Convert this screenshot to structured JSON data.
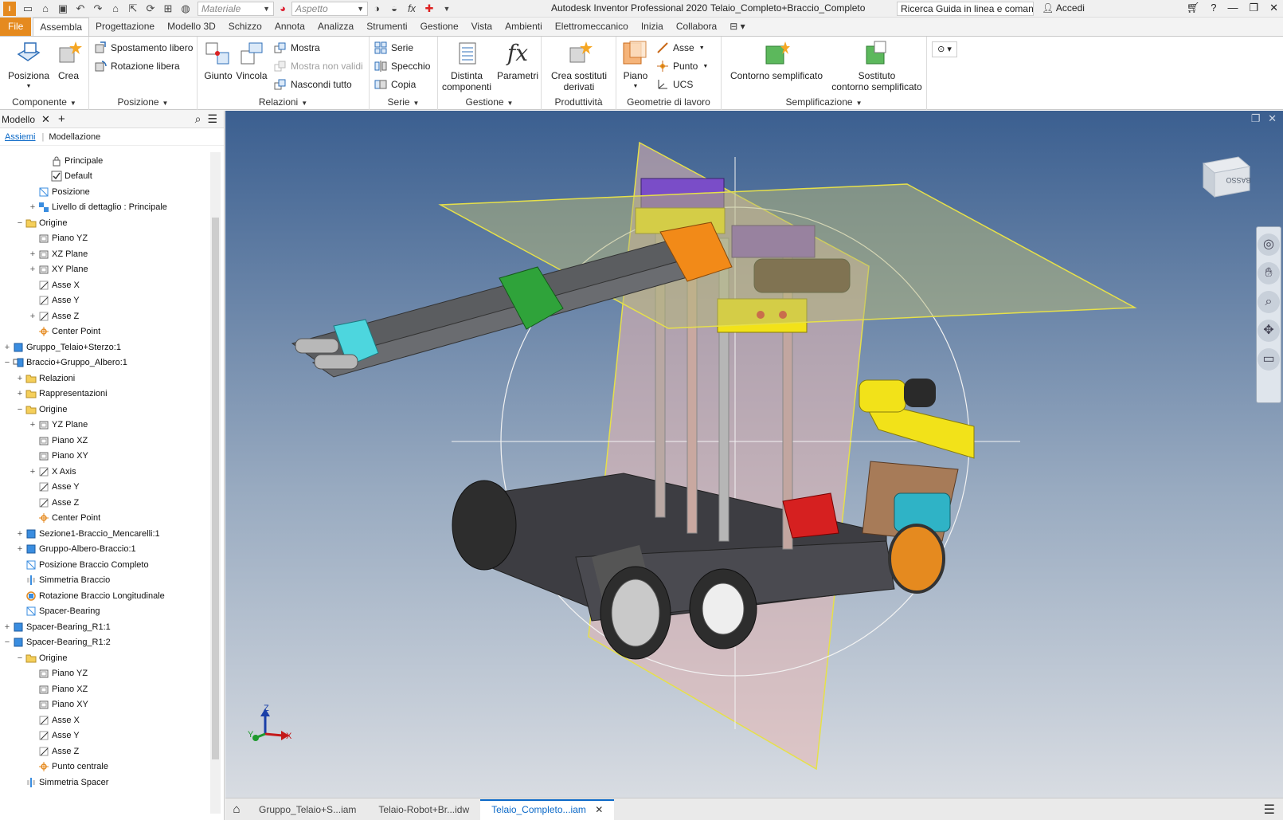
{
  "titlebar": {
    "material_placeholder": "Materiale",
    "appearance_placeholder": "Aspetto",
    "app_name": "Autodesk Inventor Professional 2020",
    "document": "Telaio_Completo+Braccio_Completo",
    "help_search": "Ricerca Guida in linea e comand",
    "sign_in": "Accedi"
  },
  "ribbon_tabs": [
    "File",
    "Assembla",
    "Progettazione",
    "Modello 3D",
    "Schizzo",
    "Annota",
    "Analizza",
    "Strumenti",
    "Gestione",
    "Vista",
    "Ambienti",
    "Elettromeccanico",
    "Inizia",
    "Collabora"
  ],
  "ribbon": {
    "componente": {
      "title": "Componente",
      "posiziona": "Posiziona",
      "crea": "Crea"
    },
    "posizione": {
      "title": "Posizione",
      "spostamento": "Spostamento libero",
      "rotazione": "Rotazione libera"
    },
    "relazioni": {
      "title": "Relazioni",
      "giunto": "Giunto",
      "vincola": "Vincola",
      "mostra": "Mostra",
      "mostra_non_validi": "Mostra non validi",
      "nascondi_tutto": "Nascondi tutto"
    },
    "serie": {
      "title": "Serie",
      "serie": "Serie",
      "specchio": "Specchio",
      "copia": "Copia"
    },
    "gestione": {
      "title": "Gestione",
      "distinta_1": "Distinta",
      "distinta_2": "componenti",
      "parametri": "Parametri"
    },
    "produttivita": {
      "title": "Produttività",
      "crea_sost_1": "Crea sostituti",
      "crea_sost_2": "derivati"
    },
    "geometrie": {
      "title": "Geometrie di lavoro",
      "piano": "Piano",
      "asse": "Asse",
      "punto": "Punto",
      "ucs": "UCS"
    },
    "semplificazione": {
      "title": "Semplificazione",
      "contorno": "Contorno semplificato",
      "sostituto_1": "Sostituto",
      "sostituto_2": "contorno semplificato"
    }
  },
  "browser": {
    "title": "Modello",
    "tab_assiemi": "Assiemi",
    "tab_modellazione": "Modellazione",
    "tree": [
      {
        "label": "Principale",
        "indent": 3,
        "exp": "",
        "icon": "lock"
      },
      {
        "label": "Default",
        "indent": 3,
        "exp": "",
        "icon": "check"
      },
      {
        "label": "Posizione",
        "indent": 2,
        "exp": "",
        "icon": "pos"
      },
      {
        "label": "Livello di dettaglio : Principale",
        "indent": 2,
        "exp": "+",
        "icon": "lod"
      },
      {
        "label": "Origine",
        "indent": 1,
        "exp": "−",
        "icon": "folder"
      },
      {
        "label": "Piano YZ",
        "indent": 2,
        "exp": "",
        "icon": "plane"
      },
      {
        "label": "XZ Plane",
        "indent": 2,
        "exp": "+",
        "icon": "plane"
      },
      {
        "label": "XY Plane",
        "indent": 2,
        "exp": "+",
        "icon": "plane"
      },
      {
        "label": "Asse X",
        "indent": 2,
        "exp": "",
        "icon": "axis"
      },
      {
        "label": "Asse Y",
        "indent": 2,
        "exp": "",
        "icon": "axis"
      },
      {
        "label": "Asse Z",
        "indent": 2,
        "exp": "+",
        "icon": "axis"
      },
      {
        "label": "Center Point",
        "indent": 2,
        "exp": "",
        "icon": "point"
      },
      {
        "label": "Gruppo_Telaio+Sterzo:1",
        "indent": 0,
        "exp": "+",
        "icon": "asm"
      },
      {
        "label": "Braccio+Gruppo_Albero:1",
        "indent": 0,
        "exp": "−",
        "icon": "asm2"
      },
      {
        "label": "Relazioni",
        "indent": 1,
        "exp": "+",
        "icon": "folder"
      },
      {
        "label": "Rappresentazioni",
        "indent": 1,
        "exp": "+",
        "icon": "folder"
      },
      {
        "label": "Origine",
        "indent": 1,
        "exp": "−",
        "icon": "folder"
      },
      {
        "label": "YZ Plane",
        "indent": 2,
        "exp": "+",
        "icon": "plane"
      },
      {
        "label": "Piano XZ",
        "indent": 2,
        "exp": "",
        "icon": "plane"
      },
      {
        "label": "Piano XY",
        "indent": 2,
        "exp": "",
        "icon": "plane"
      },
      {
        "label": "X Axis",
        "indent": 2,
        "exp": "+",
        "icon": "axis"
      },
      {
        "label": "Asse Y",
        "indent": 2,
        "exp": "",
        "icon": "axis"
      },
      {
        "label": "Asse Z",
        "indent": 2,
        "exp": "",
        "icon": "axis"
      },
      {
        "label": "Center Point",
        "indent": 2,
        "exp": "",
        "icon": "point"
      },
      {
        "label": "Sezione1-Braccio_Mencarelli:1",
        "indent": 1,
        "exp": "+",
        "icon": "asm"
      },
      {
        "label": "Gruppo-Albero-Braccio:1",
        "indent": 1,
        "exp": "+",
        "icon": "asm"
      },
      {
        "label": "Posizione Braccio Completo",
        "indent": 1,
        "exp": "",
        "icon": "pos"
      },
      {
        "label": "Simmetria Braccio",
        "indent": 1,
        "exp": "",
        "icon": "sym"
      },
      {
        "label": "Rotazione Braccio  Longitudinale",
        "indent": 1,
        "exp": "",
        "icon": "rot"
      },
      {
        "label": "Spacer-Bearing",
        "indent": 1,
        "exp": "",
        "icon": "pos"
      },
      {
        "label": "Spacer-Bearing_R1:1",
        "indent": 0,
        "exp": "+",
        "icon": "asm"
      },
      {
        "label": "Spacer-Bearing_R1:2",
        "indent": 0,
        "exp": "−",
        "icon": "asm"
      },
      {
        "label": "Origine",
        "indent": 1,
        "exp": "−",
        "icon": "folder"
      },
      {
        "label": "Piano YZ",
        "indent": 2,
        "exp": "",
        "icon": "plane"
      },
      {
        "label": "Piano XZ",
        "indent": 2,
        "exp": "",
        "icon": "plane"
      },
      {
        "label": "Piano XY",
        "indent": 2,
        "exp": "",
        "icon": "plane"
      },
      {
        "label": "Asse X",
        "indent": 2,
        "exp": "",
        "icon": "axis"
      },
      {
        "label": "Asse Y",
        "indent": 2,
        "exp": "",
        "icon": "axis"
      },
      {
        "label": "Asse Z",
        "indent": 2,
        "exp": "",
        "icon": "axis"
      },
      {
        "label": "Punto centrale",
        "indent": 2,
        "exp": "",
        "icon": "point"
      },
      {
        "label": "Simmetria Spacer",
        "indent": 1,
        "exp": "",
        "icon": "sym"
      }
    ]
  },
  "viewport": {
    "viewcube_label": "BASSO",
    "axis_x": "X",
    "axis_y": "Y",
    "axis_z": "Z"
  },
  "doc_tabs": [
    "Gruppo_Telaio+S...iam",
    "Telaio-Robot+Br...idw",
    "Telaio_Completo...iam"
  ],
  "colors": {
    "accent": "#0a68c7",
    "file_tab": "#e58a1f"
  }
}
